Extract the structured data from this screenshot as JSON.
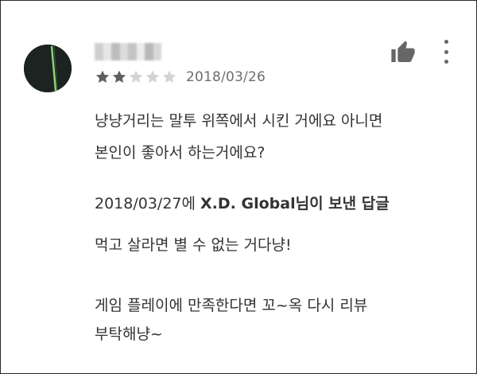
{
  "review": {
    "rating": 2,
    "max_rating": 5,
    "date": "2018/03/26",
    "text_lines": [
      "냥냥거리는 말투 위쪽에서 시킨 거에요 아니면",
      "본인이 좋아서 하는거에요?"
    ]
  },
  "reply": {
    "date_prefix": "2018/03/27에 ",
    "developer": "X.D. Global",
    "suffix": "님이 보낸 답글",
    "text_lines": [
      "먹고 살라면 별 수 없는 거다냥!",
      "게임 플레이에 만족한다면 꼬~옥 다시 리뷰",
      "부탁해냥~"
    ]
  },
  "colors": {
    "star_filled": "#5f5f5f",
    "star_empty": "#d4d4d4",
    "accent_green": "#8fd47a",
    "avatar_bg": "#1c2320",
    "icon_gray": "#666666"
  },
  "icons": {
    "like": "thumbs-up-icon",
    "menu": "more-vertical-icon"
  }
}
